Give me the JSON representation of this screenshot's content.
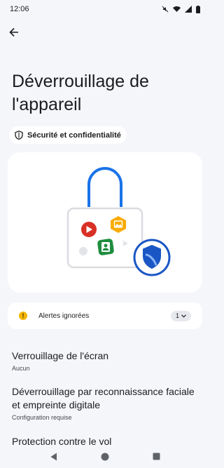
{
  "status_bar": {
    "time": "12:06",
    "icons": [
      "mute-icon",
      "wifi-icon",
      "signal-icon",
      "battery-icon"
    ]
  },
  "header": {
    "back_icon": "back-arrow-icon",
    "title": "Déverrouillage de l'appareil"
  },
  "chip": {
    "icon": "shield-icon",
    "label": "Sécurité et confidentialité"
  },
  "illustration": {
    "description_icons": [
      "padlock",
      "youtube-badge",
      "photos-badge",
      "contacts-badge",
      "shield-badge"
    ],
    "colors": {
      "shackle": "#1a73e8",
      "body": "#e0e0e0",
      "red_badge": "#d93025",
      "yellow_badge": "#f9ab00",
      "green_badge": "#1e8e3e",
      "shield": "#1a56c4"
    }
  },
  "alerts": {
    "icon": "warning-icon",
    "label": "Alertes ignorées",
    "count": "1",
    "color": "#f4b400"
  },
  "settings": [
    {
      "title": "Verrouillage de l'écran",
      "subtitle": "Aucun"
    },
    {
      "title": "Déverrouillage par reconnaissance faciale et empreinte digitale",
      "subtitle": "Configuration requise"
    },
    {
      "title": "Protection contre le vol",
      "subtitle": ""
    }
  ],
  "nav_bar": {
    "icons": [
      "back-triangle-icon",
      "home-circle-icon",
      "recents-square-icon"
    ]
  }
}
